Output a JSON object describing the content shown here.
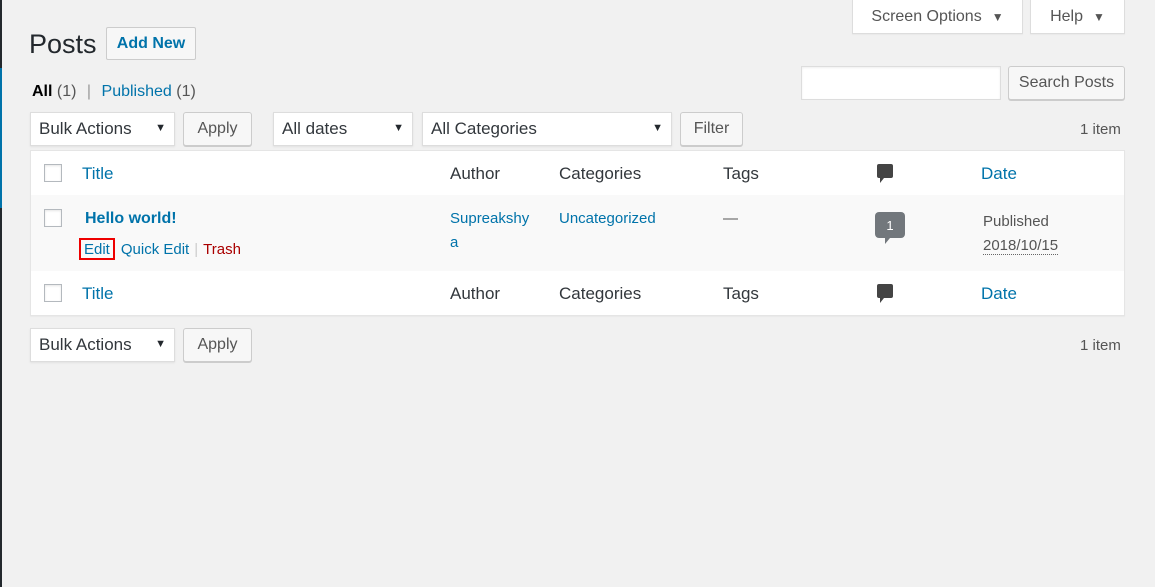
{
  "header": {
    "title": "Posts",
    "add_new": "Add New",
    "screen_options": "Screen Options",
    "help": "Help"
  },
  "views": {
    "all_label": "All",
    "all_count": "(1)",
    "published_label": "Published",
    "published_count": "(1)",
    "separator": "|"
  },
  "search": {
    "placeholder": "",
    "button": "Search Posts"
  },
  "top_nav": {
    "bulk_actions": "Bulk Actions",
    "apply": "Apply",
    "dates": "All dates",
    "categories": "All Categories",
    "filter": "Filter",
    "item_count": "1 item"
  },
  "table": {
    "columns": {
      "title": "Title",
      "author": "Author",
      "categories": "Categories",
      "tags": "Tags",
      "date": "Date"
    },
    "rows": [
      {
        "title": "Hello world!",
        "actions": {
          "edit": "Edit",
          "quick_edit": "Quick Edit",
          "trash": "Trash",
          "separator": "|"
        },
        "author_line1": "Supreakshy",
        "author_line2": "a",
        "categories": "Uncategorized",
        "tags": "—",
        "comments": "1",
        "status": "Published",
        "date": "2018/10/15"
      }
    ]
  },
  "bottom_nav": {
    "bulk_actions": "Bulk Actions",
    "apply": "Apply",
    "item_count": "1 item"
  },
  "icons": {
    "dropdown": "caret-down-icon",
    "comments": "comment-bubble-icon"
  },
  "colors": {
    "link": "#0073aa",
    "trash": "#a00",
    "highlight": "#e00",
    "background": "#f1f1f1"
  }
}
